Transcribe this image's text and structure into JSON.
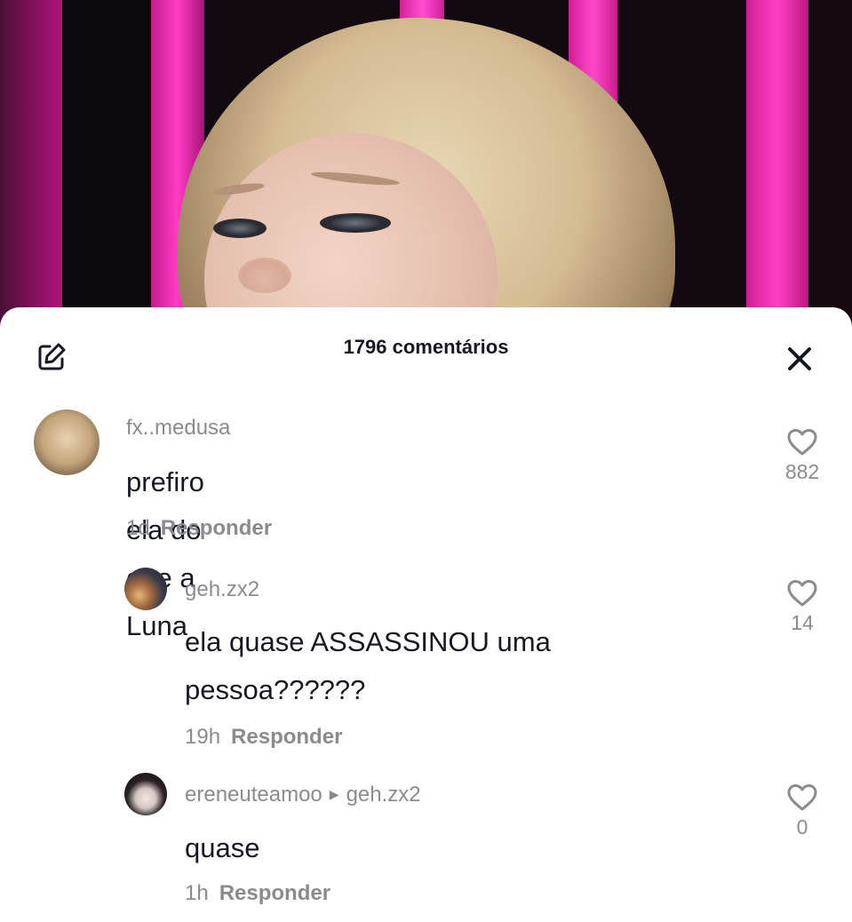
{
  "comments_panel": {
    "title": "1796 comentários",
    "comments": [
      {
        "username": "fx..medusa",
        "text": "prefiro ela do que a Luna",
        "time": "1d",
        "reply_label": "Responder",
        "likes": "882"
      },
      {
        "username": "geh.zx2",
        "text": "ela quase ASSASSINOU uma pessoa??????",
        "time": "19h",
        "reply_label": "Responder",
        "likes": "14"
      },
      {
        "username": "ereneuteamoo",
        "reply_to": "geh.zx2",
        "text": "quase",
        "time": "1h",
        "reply_label": "Responder",
        "likes": "0"
      }
    ]
  },
  "colors": {
    "text_primary": "#161823",
    "text_secondary": "#8a8b91",
    "background": "#ffffff",
    "stage_pink": "#ff3cc4"
  },
  "icons": {
    "compose": "edit-icon",
    "close": "close-icon",
    "like": "heart-outline-icon"
  }
}
